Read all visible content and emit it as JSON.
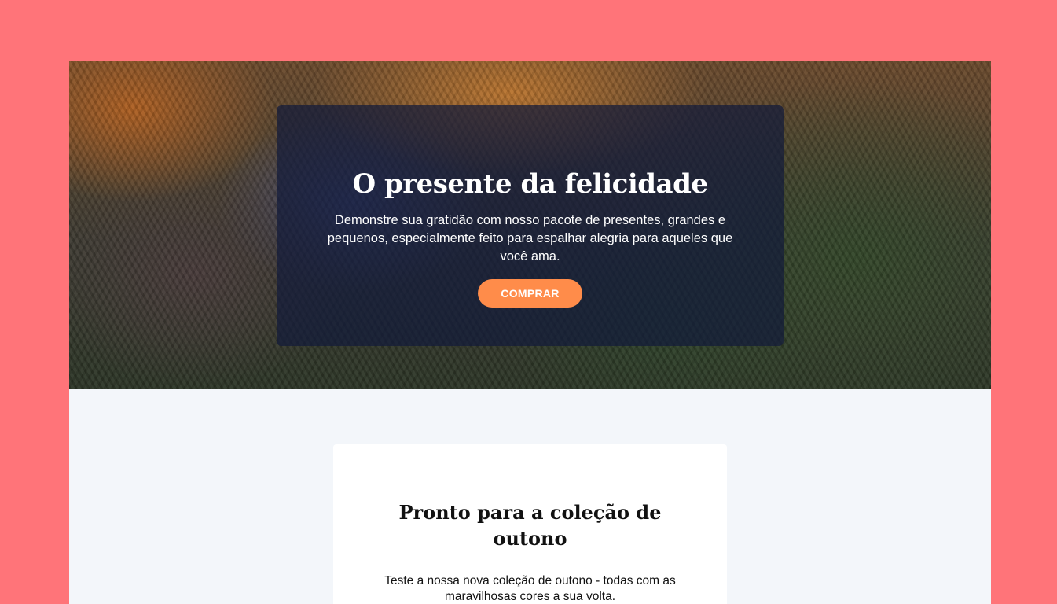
{
  "colors": {
    "background": "#ff7479",
    "page": "#f3f6fa",
    "overlay": "#121a3a",
    "button": "#ff8c4a",
    "card": "#ffffff"
  },
  "hero": {
    "image": "knitted-sweaters-photo",
    "title": "O presente da felicidade",
    "text": "Demonstre sua gratidão com nosso pacote de presentes, grandes e pequenos, especialmente feito para espalhar alegria para aqueles que você ama.",
    "button_label": "COMPRAR"
  },
  "collection": {
    "title": "Pronto para a coleção de outono",
    "text": "Teste a nossa nova coleção de outono - todas com as maravilhosas cores a sua volta."
  }
}
